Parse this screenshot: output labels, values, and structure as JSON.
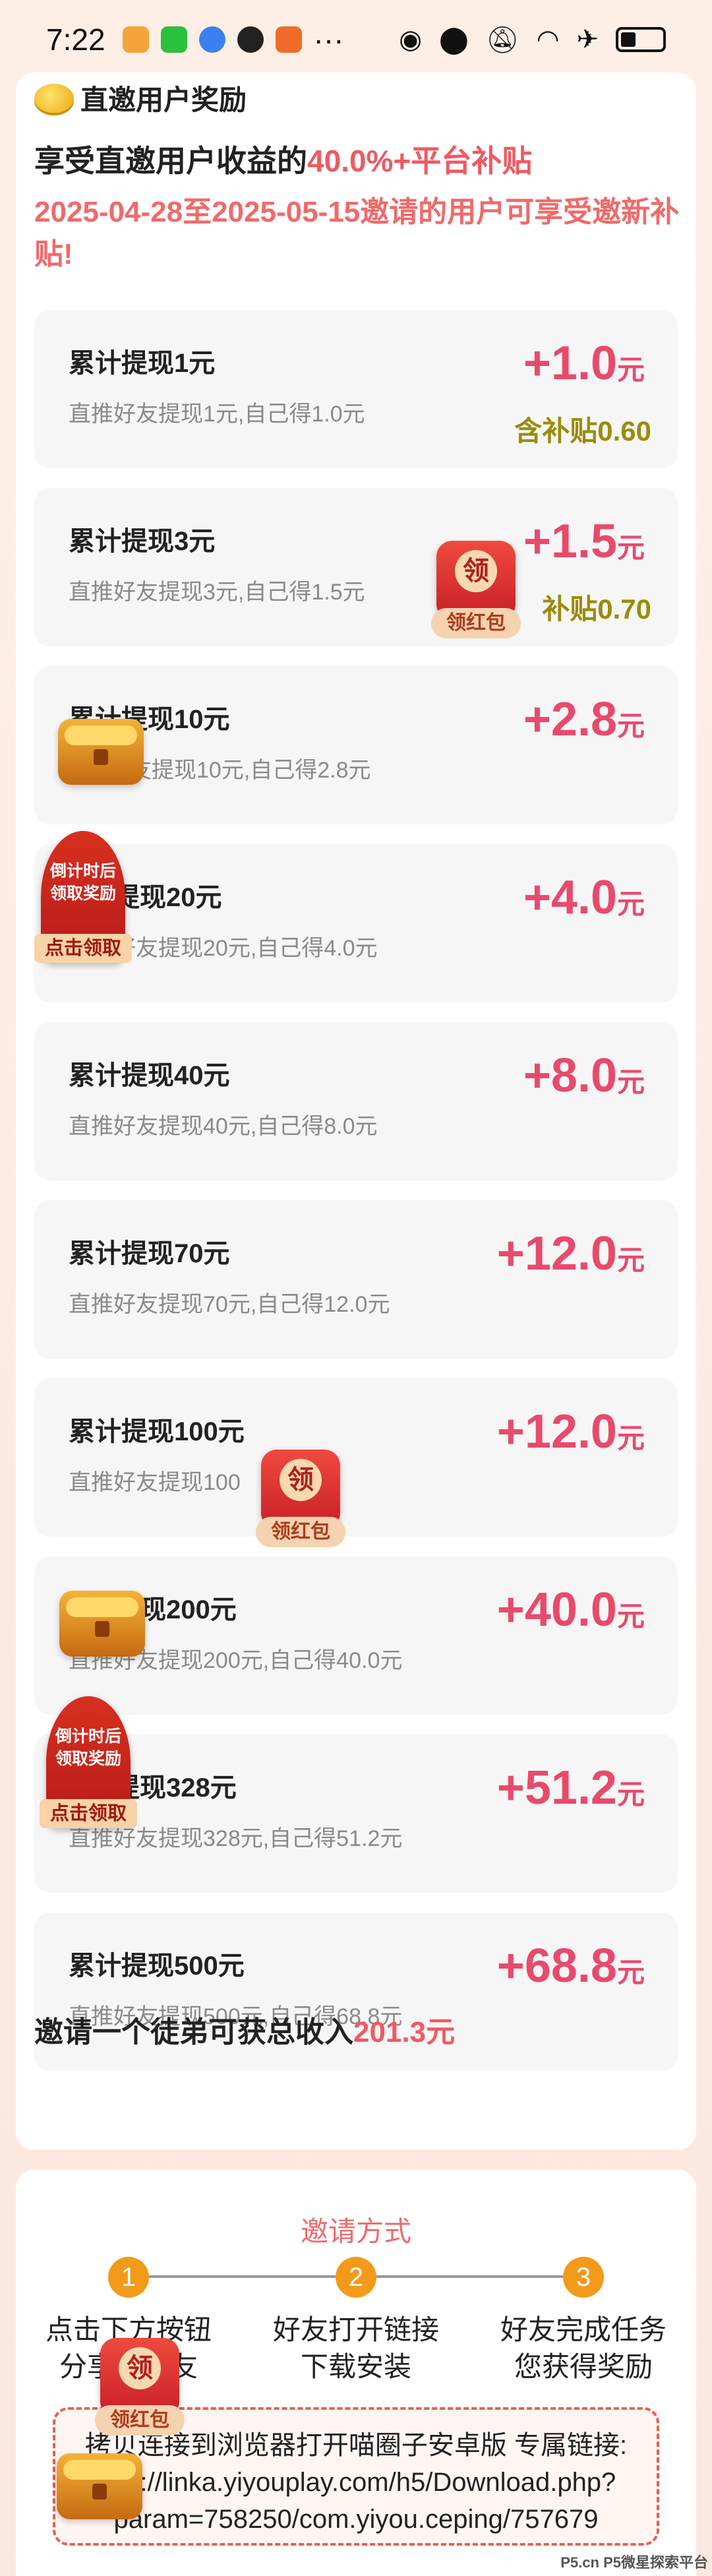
{
  "status": {
    "time": "7:22",
    "icons": [
      "cat-app-icon",
      "wechat-icon",
      "music-icon",
      "qq-icon",
      "bonus-app-icon",
      "more-dots-icon",
      "eye-icon",
      "location-icon",
      "mute-icon",
      "wifi-icon",
      "airplane-icon",
      "battery-icon"
    ],
    "more": "···"
  },
  "header": {
    "title": "直邀用户奖励",
    "subtitle_prefix": "享受直邀用户收益的",
    "subtitle_highlight": "40.0%+平台补贴",
    "notice": "2025-04-28至2025-05-15邀请的用户可享受邀新补贴!"
  },
  "tiers": [
    {
      "title": "累计提现1元",
      "desc": "直推好友提现1元,自己得1.0元",
      "amount": "+1.0",
      "unit": "元",
      "subsidy": "含补贴0.60"
    },
    {
      "title": "累计提现3元",
      "desc": "直推好友提现3元,自己得1.5元",
      "amount": "+1.5",
      "unit": "元",
      "subsidy": "补贴0.70"
    },
    {
      "title": "累计提现10元",
      "desc": "好友提现10元,自己得2.8元",
      "amount": "+2.8",
      "unit": "元",
      "subsidy": ""
    },
    {
      "title": "提现20元",
      "desc": "好友提现20元,自己得4.0元",
      "amount": "+4.0",
      "unit": "元",
      "subsidy": ""
    },
    {
      "title": "累计提现40元",
      "desc": "直推好友提现40元,自己得8.0元",
      "amount": "+8.0",
      "unit": "元",
      "subsidy": ""
    },
    {
      "title": "累计提现70元",
      "desc": "直推好友提现70元,自己得12.0元",
      "amount": "+12.0",
      "unit": "元",
      "subsidy": ""
    },
    {
      "title": "累计提现100元",
      "desc": "直推好友提现100",
      "amount": "+12.0",
      "unit": "元",
      "subsidy": ""
    },
    {
      "title": "提现200元",
      "desc": "直推好友提现200元,自己得40.0元",
      "amount": "+40.0",
      "unit": "元",
      "subsidy": ""
    },
    {
      "title": "提现328元",
      "desc": "直推好友提现328元,自己得51.2元",
      "amount": "+51.2",
      "unit": "元",
      "subsidy": ""
    },
    {
      "title": "累计提现500元",
      "desc": "直推好友提现500元,自己得68.8元",
      "amount": "+68.8",
      "unit": "元",
      "subsidy": ""
    }
  ],
  "summary": {
    "prefix": "邀请一个徒弟可获总收入",
    "highlight": "201.3元"
  },
  "invite": {
    "title": "邀请方式",
    "steps": [
      {
        "num": "1",
        "text": "点击下方按钮 分享给好友"
      },
      {
        "num": "2",
        "text": "好友打开链接 下载安装"
      },
      {
        "num": "3",
        "text": "好友完成任务 您获得奖励"
      }
    ],
    "link_text": "拷贝连接到浏览器打开喵圈子安卓版 专属链接: http://linka.yiyouplay.com/h5/Download.php?param=758250/com.yiyou.ceping/757679"
  },
  "widgets": {
    "redpack_char": "领",
    "redpack_label": "领红包",
    "countdown_text": "倒计时后 领取奖励",
    "countdown_btn": "点击领取"
  },
  "watermark": "P5.cn P5微星探索平台",
  "colors": {
    "accent": "#e84a6c",
    "highlight": "#ef5a62",
    "subsidy": "#9a8c0b",
    "step": "#f39a1b"
  }
}
